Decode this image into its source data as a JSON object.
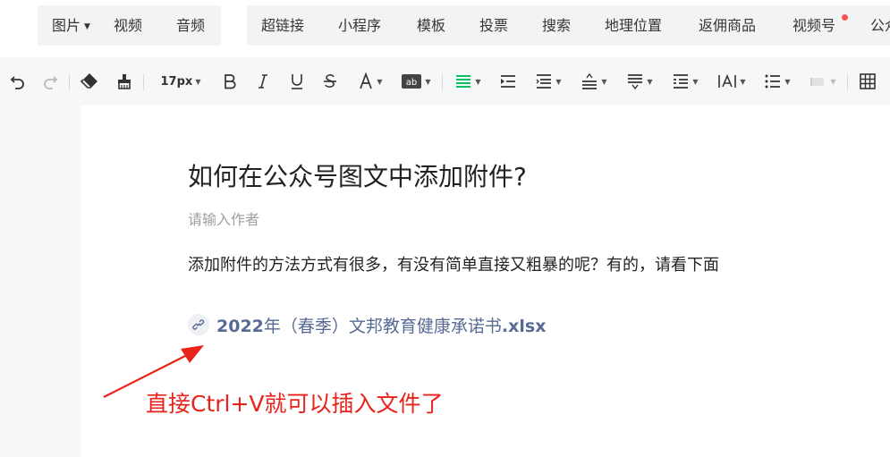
{
  "media_tabs": [
    {
      "label": "图片",
      "has_dropdown": true
    },
    {
      "label": "视频"
    },
    {
      "label": "音频"
    }
  ],
  "insert_tabs": [
    {
      "label": "超链接"
    },
    {
      "label": "小程序"
    },
    {
      "label": "模板"
    },
    {
      "label": "投票"
    },
    {
      "label": "搜索"
    },
    {
      "label": "地理位置"
    },
    {
      "label": "返佣商品"
    },
    {
      "label": "视频号",
      "has_badge": true
    },
    {
      "label": "公众"
    }
  ],
  "toolbar": {
    "font_size": "17px",
    "icons": [
      "undo-icon",
      "redo-icon",
      "eraser-icon",
      "format-painter-icon",
      "font-size-select",
      "bold-icon",
      "italic-icon",
      "underline-icon",
      "strikethrough-icon",
      "font-color-icon",
      "background-color-icon",
      "align-icon",
      "indent-icon",
      "line-height-icon",
      "paragraph-spacing-icon",
      "para-before-icon",
      "para-after-icon",
      "letter-spacing-icon",
      "list-icon",
      "block-style-icon",
      "table-icon"
    ],
    "align_active_color": "#07c160"
  },
  "article": {
    "title": "如何在公众号图文中添加附件?",
    "author_placeholder": "请输入作者",
    "body": "添加附件的方法方式有很多，有没有简单直接又粗暴的呢？有的，请看下面",
    "attachment": {
      "year": "2022",
      "middle": "年（春季）文邦教育健康承诺书",
      "ext": ".xlsx",
      "icon": "link-icon"
    }
  },
  "annotation": {
    "text": "直接Ctrl+V就可以插入文件了",
    "color": "#e8231b"
  }
}
